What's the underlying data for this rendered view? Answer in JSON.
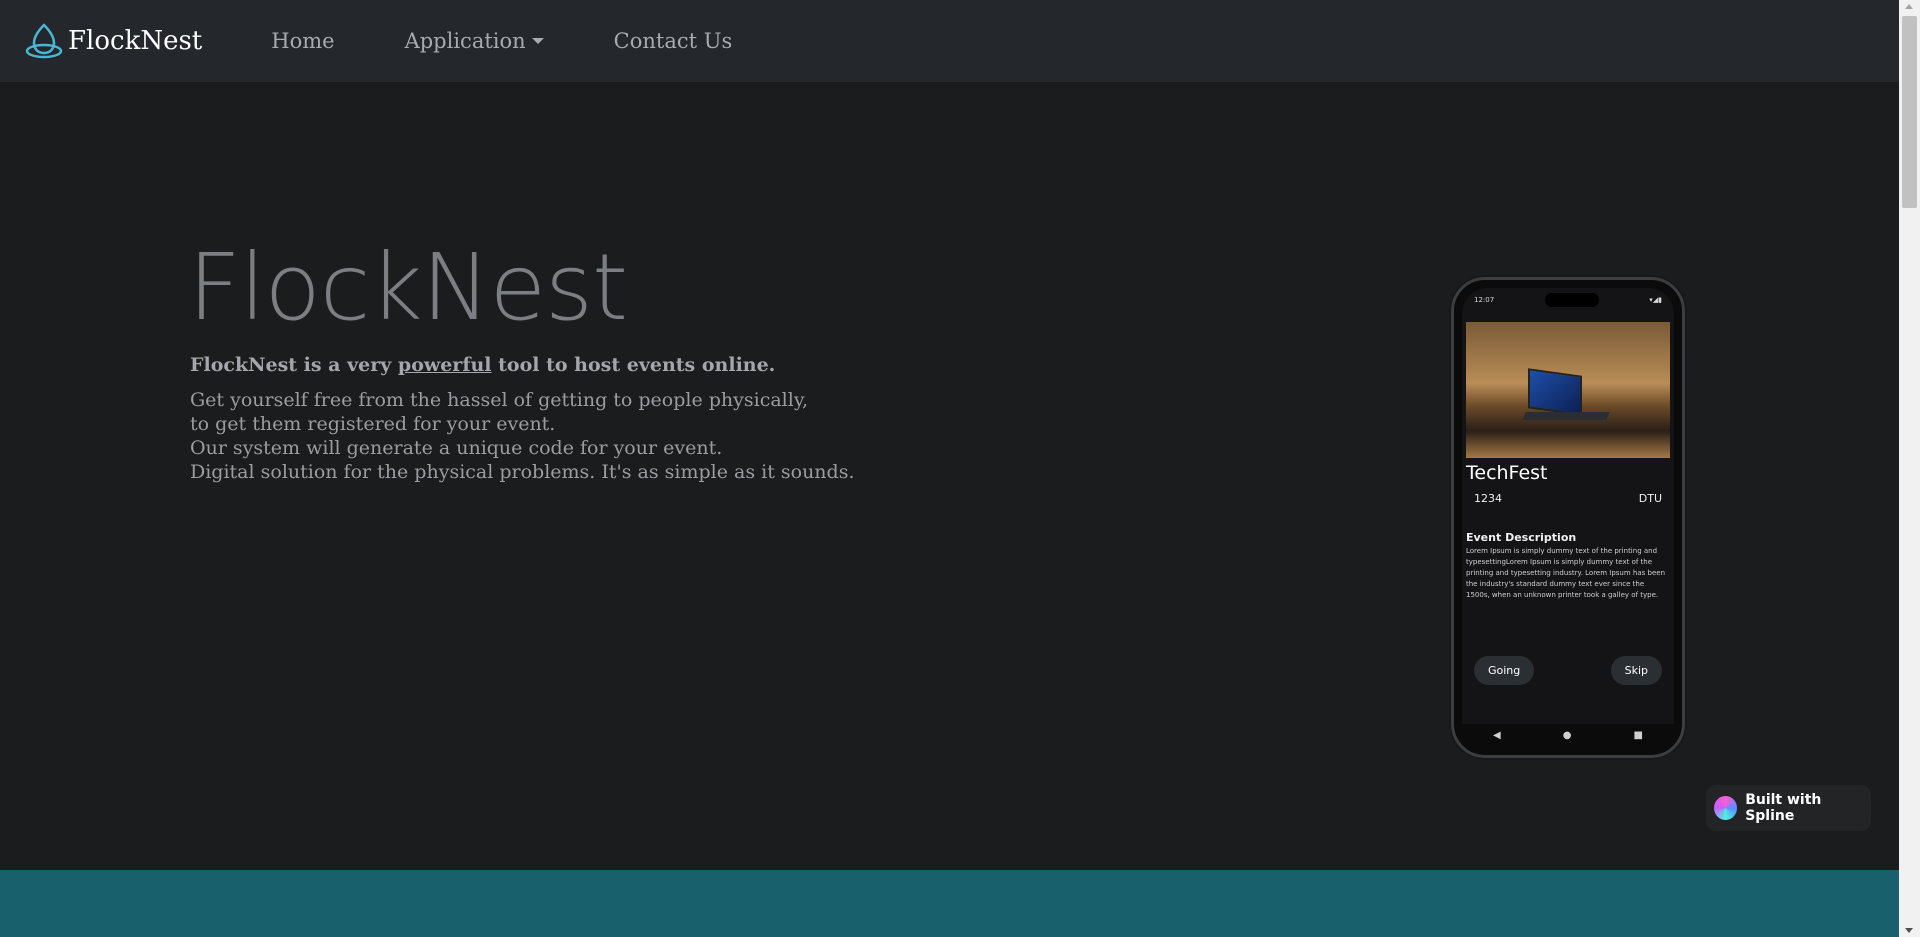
{
  "navbar": {
    "brand": "FlockNest",
    "links": [
      {
        "label": "Home"
      },
      {
        "label": "Application"
      },
      {
        "label": "Contact Us"
      }
    ]
  },
  "hero": {
    "title": "FlockNest",
    "tagline_prefix": "FlockNest is a very ",
    "tagline_emphasis": "powerful",
    "tagline_suffix": " tool to host events online.",
    "lines": [
      "Get yourself free from the hassel of getting to people physically,",
      "to get them registered for your event.",
      "Our system will generate a unique code for your event.",
      "Digital solution for the physical problems. It's as simple as it sounds."
    ]
  },
  "phone": {
    "time": "12:07",
    "event_title": "TechFest",
    "code": "1234",
    "org": "DTU",
    "description_heading": "Event Description",
    "description": "Lorem Ipsum is simply dummy text of the printing and typesettingLorem Ipsum is simply dummy text of the printing and typesetting industry. Lorem Ipsum has been the industry's standard dummy text ever since the 1500s, when an unknown printer took a galley of type.",
    "going_label": "Going",
    "skip_label": "Skip"
  },
  "badge": {
    "label": "Built with Spline"
  }
}
